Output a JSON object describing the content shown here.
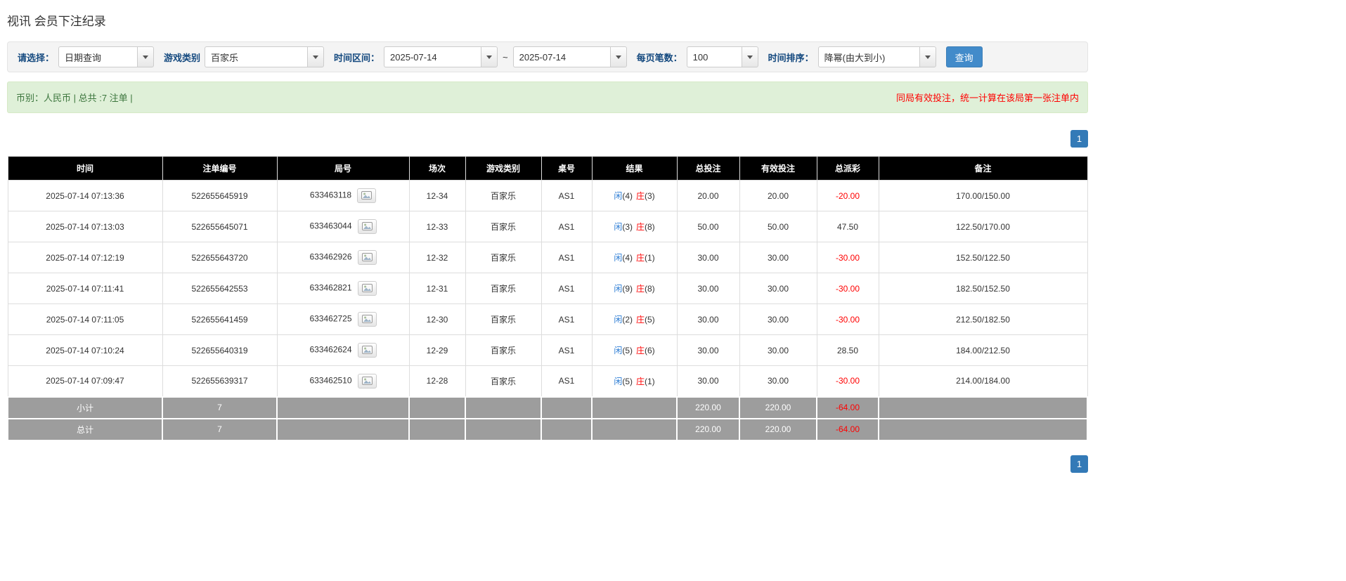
{
  "page": {
    "title": "视讯 会员下注纪录"
  },
  "colors": {
    "accent_blue": "#337ab7",
    "button_blue": "#428bca",
    "link_blue": "#2b7cd4",
    "negative_red": "#ff0000",
    "notice_red": "#ff0000",
    "player_blue": "#2b7cd4",
    "banker_red": "#ff0000",
    "header_black": "#000000",
    "footer_gray": "#9d9d9d",
    "success_bg": "#dff0d8",
    "label_navy": "#14497f"
  },
  "filters": {
    "select_label": "请选择：",
    "select_value": "日期查询",
    "game_label": "游戏类别",
    "game_value": "百家乐",
    "range_label": "时间区间：",
    "date_from": "2025-07-14",
    "range_sep": "~",
    "date_to": "2025-07-14",
    "page_size_label": "每页笔数：",
    "page_size_value": "100",
    "sort_label": "时间排序：",
    "sort_value": "降幂(由大到小)",
    "search_button": "查询"
  },
  "info_bar": {
    "summary": "币别：人民币 | 总共 :7 注单 |",
    "notice": "同局有效投注，统一计算在该局第一张注单内"
  },
  "pagination": {
    "page": "1"
  },
  "table": {
    "headers": [
      "时间",
      "注单编号",
      "局号",
      "场次",
      "游戏类别",
      "桌号",
      "结果",
      "总投注",
      "有效投注",
      "总派彩",
      "备注"
    ],
    "rows": [
      {
        "time": "2025-07-14 07:13:36",
        "bet_no": "522655645919",
        "round_no": "633463118",
        "session": "12-34",
        "game": "百家乐",
        "table_no": "AS1",
        "result_player_label": "闲",
        "result_player_value": "(4)",
        "result_banker_label": "庄",
        "result_banker_value": "(3)",
        "total_bet": "20.00",
        "valid_bet": "20.00",
        "payout": "-20.00",
        "remark": "170.00/150.00"
      },
      {
        "time": "2025-07-14 07:13:03",
        "bet_no": "522655645071",
        "round_no": "633463044",
        "session": "12-33",
        "game": "百家乐",
        "table_no": "AS1",
        "result_player_label": "闲",
        "result_player_value": "(3)",
        "result_banker_label": "庄",
        "result_banker_value": "(8)",
        "total_bet": "50.00",
        "valid_bet": "50.00",
        "payout": "47.50",
        "remark": "122.50/170.00"
      },
      {
        "time": "2025-07-14 07:12:19",
        "bet_no": "522655643720",
        "round_no": "633462926",
        "session": "12-32",
        "game": "百家乐",
        "table_no": "AS1",
        "result_player_label": "闲",
        "result_player_value": "(4)",
        "result_banker_label": "庄",
        "result_banker_value": "(1)",
        "total_bet": "30.00",
        "valid_bet": "30.00",
        "payout": "-30.00",
        "remark": "152.50/122.50"
      },
      {
        "time": "2025-07-14 07:11:41",
        "bet_no": "522655642553",
        "round_no": "633462821",
        "session": "12-31",
        "game": "百家乐",
        "table_no": "AS1",
        "result_player_label": "闲",
        "result_player_value": "(9)",
        "result_banker_label": "庄",
        "result_banker_value": "(8)",
        "total_bet": "30.00",
        "valid_bet": "30.00",
        "payout": "-30.00",
        "remark": "182.50/152.50"
      },
      {
        "time": "2025-07-14 07:11:05",
        "bet_no": "522655641459",
        "round_no": "633462725",
        "session": "12-30",
        "game": "百家乐",
        "table_no": "AS1",
        "result_player_label": "闲",
        "result_player_value": "(2)",
        "result_banker_label": "庄",
        "result_banker_value": "(5)",
        "total_bet": "30.00",
        "valid_bet": "30.00",
        "payout": "-30.00",
        "remark": "212.50/182.50"
      },
      {
        "time": "2025-07-14 07:10:24",
        "bet_no": "522655640319",
        "round_no": "633462624",
        "session": "12-29",
        "game": "百家乐",
        "table_no": "AS1",
        "result_player_label": "闲",
        "result_player_value": "(5)",
        "result_banker_label": "庄",
        "result_banker_value": "(6)",
        "total_bet": "30.00",
        "valid_bet": "30.00",
        "payout": "28.50",
        "remark": "184.00/212.50"
      },
      {
        "time": "2025-07-14 07:09:47",
        "bet_no": "522655639317",
        "round_no": "633462510",
        "session": "12-28",
        "game": "百家乐",
        "table_no": "AS1",
        "result_player_label": "闲",
        "result_player_value": "(5)",
        "result_banker_label": "庄",
        "result_banker_value": "(1)",
        "total_bet": "30.00",
        "valid_bet": "30.00",
        "payout": "-30.00",
        "remark": "214.00/184.00"
      }
    ],
    "subtotal": {
      "label": "小计",
      "count": "7",
      "total_bet": "220.00",
      "valid_bet": "220.00",
      "payout": "-64.00"
    },
    "total": {
      "label": "总计",
      "count": "7",
      "total_bet": "220.00",
      "valid_bet": "220.00",
      "payout": "-64.00"
    }
  }
}
